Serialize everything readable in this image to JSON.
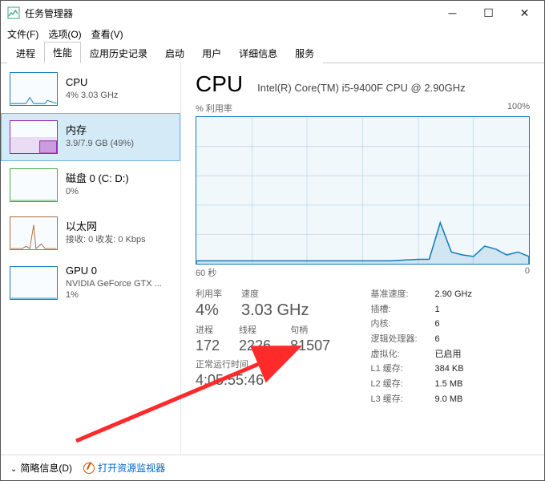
{
  "title": "任务管理器",
  "menus": {
    "file": "文件(F)",
    "options": "选项(O)",
    "view": "查看(V)"
  },
  "tabs": [
    "进程",
    "性能",
    "应用历史记录",
    "启动",
    "用户",
    "详细信息",
    "服务"
  ],
  "active_tab": 1,
  "sidebar": [
    {
      "name": "CPU",
      "sub": "4% 3.03 GHz",
      "kind": "cpu",
      "selected": false
    },
    {
      "name": "内存",
      "sub": "3.9/7.9 GB (49%)",
      "kind": "mem",
      "selected": true
    },
    {
      "name": "磁盘 0 (C: D:)",
      "sub": "0%",
      "kind": "disk",
      "selected": false
    },
    {
      "name": "以太网",
      "sub": "接收: 0 收发: 0 Kbps",
      "kind": "eth",
      "selected": false
    },
    {
      "name": "GPU 0",
      "sub": "NVIDIA GeForce GTX ...",
      "sub2": "1%",
      "kind": "gpu",
      "selected": false
    }
  ],
  "detail": {
    "title": "CPU",
    "model": "Intel(R) Core(TM) i5-9400F CPU @ 2.90GHz",
    "chart_label_left": "% 利用率",
    "chart_label_right": "100%",
    "chart_bottom_left": "60 秒",
    "chart_bottom_right": "0",
    "stats_left": {
      "util_lbl": "利用率",
      "util_val": "4%",
      "speed_lbl": "速度",
      "speed_val": "3.03 GHz",
      "proc_lbl": "进程",
      "proc_val": "172",
      "thread_lbl": "线程",
      "thread_val": "2226",
      "handle_lbl": "句柄",
      "handle_val": "81507",
      "uptime_lbl": "正常运行时间",
      "uptime_val": "4:05:55:46"
    },
    "stats_right": [
      {
        "k": "基准速度:",
        "v": "2.90 GHz"
      },
      {
        "k": "插槽:",
        "v": "1"
      },
      {
        "k": "内核:",
        "v": "6"
      },
      {
        "k": "逻辑处理器:",
        "v": "6"
      },
      {
        "k": "虚拟化:",
        "v": "已启用"
      },
      {
        "k": "L1 缓存:",
        "v": "384 KB"
      },
      {
        "k": "L2 缓存:",
        "v": "1.5 MB"
      },
      {
        "k": "L3 缓存:",
        "v": "9.0 MB"
      }
    ]
  },
  "footer": {
    "brief": "简略信息(D)",
    "monitor": "打开资源监视器"
  },
  "chart_data": {
    "type": "line",
    "title": "% 利用率",
    "xlabel": "秒",
    "ylabel": "%",
    "ylim": [
      0,
      100
    ],
    "xlim": [
      60,
      0
    ],
    "x": [
      60,
      55,
      50,
      45,
      40,
      35,
      30,
      25,
      20,
      18,
      16,
      14,
      12,
      10,
      8,
      6,
      4,
      2,
      0
    ],
    "values": [
      2,
      2,
      2,
      2,
      2,
      2,
      2,
      2,
      3,
      3,
      28,
      8,
      6,
      5,
      12,
      10,
      6,
      8,
      5
    ]
  },
  "accent": "#117dbb"
}
